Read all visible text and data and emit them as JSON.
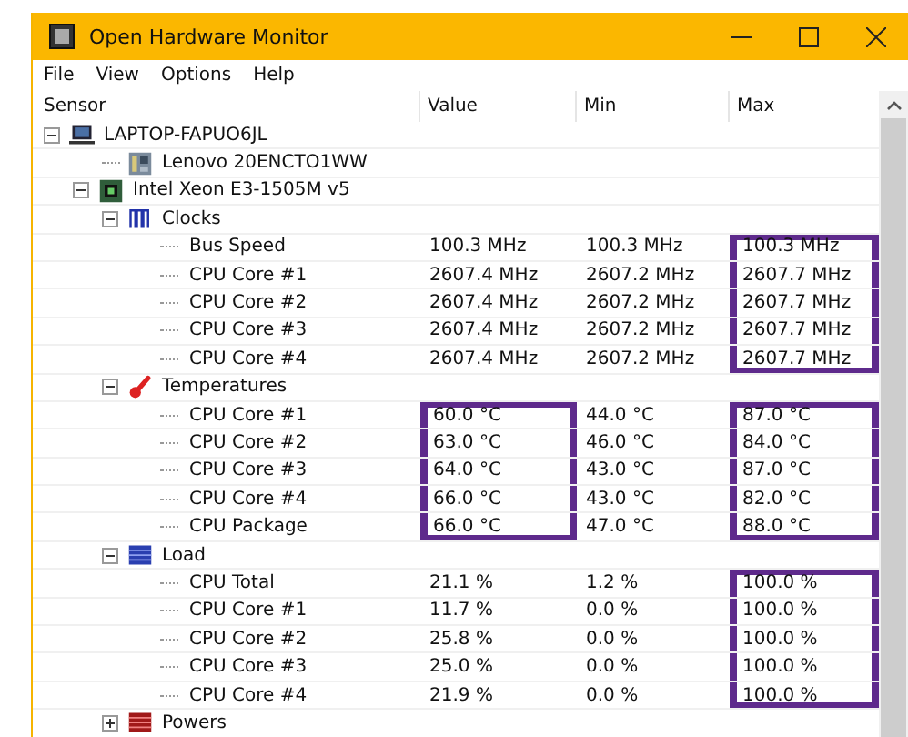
{
  "window": {
    "title": "Open Hardware Monitor"
  },
  "menu": [
    "File",
    "View",
    "Options",
    "Help"
  ],
  "columns": [
    "Sensor",
    "Value",
    "Min",
    "Max"
  ],
  "tree": [
    {
      "name": "LAPTOP-FAPUO6JL",
      "kind": "computer",
      "expanded": true,
      "children": [
        {
          "name": "Lenovo 20ENCTO1WW",
          "kind": "motherboard"
        },
        {
          "name": "Intel Xeon E3-1505M v5",
          "kind": "cpu",
          "expanded": true,
          "children": [
            {
              "name": "Clocks",
              "kind": "clock",
              "expanded": true,
              "children": [
                {
                  "name": "Bus Speed",
                  "value": {
                    "text": "100.3 MHz",
                    "boxed": false
                  },
                  "min": {
                    "text": "100.3 MHz",
                    "boxed": false
                  },
                  "max": {
                    "text": "100.3 MHz",
                    "boxed": true
                  }
                },
                {
                  "name": "CPU Core #1",
                  "value": {
                    "text": "2607.4 MHz",
                    "boxed": false
                  },
                  "min": {
                    "text": "2607.2 MHz",
                    "boxed": false
                  },
                  "max": {
                    "text": "2607.7 MHz",
                    "boxed": true
                  }
                },
                {
                  "name": "CPU Core #2",
                  "value": {
                    "text": "2607.4 MHz",
                    "boxed": false
                  },
                  "min": {
                    "text": "2607.2 MHz",
                    "boxed": false
                  },
                  "max": {
                    "text": "2607.7 MHz",
                    "boxed": true
                  }
                },
                {
                  "name": "CPU Core #3",
                  "value": {
                    "text": "2607.4 MHz",
                    "boxed": false
                  },
                  "min": {
                    "text": "2607.2 MHz",
                    "boxed": false
                  },
                  "max": {
                    "text": "2607.7 MHz",
                    "boxed": true
                  }
                },
                {
                  "name": "CPU Core #4",
                  "value": {
                    "text": "2607.4 MHz",
                    "boxed": false
                  },
                  "min": {
                    "text": "2607.2 MHz",
                    "boxed": false
                  },
                  "max": {
                    "text": "2607.7 MHz",
                    "boxed": true
                  }
                }
              ]
            },
            {
              "name": "Temperatures",
              "kind": "temperature",
              "expanded": true,
              "children": [
                {
                  "name": "CPU Core #1",
                  "value": {
                    "text": "60.0 °C",
                    "boxed": true
                  },
                  "min": {
                    "text": "44.0 °C",
                    "boxed": false
                  },
                  "max": {
                    "text": "87.0 °C",
                    "boxed": true
                  }
                },
                {
                  "name": "CPU Core #2",
                  "value": {
                    "text": "63.0 °C",
                    "boxed": true
                  },
                  "min": {
                    "text": "46.0 °C",
                    "boxed": false
                  },
                  "max": {
                    "text": "84.0 °C",
                    "boxed": true
                  }
                },
                {
                  "name": "CPU Core #3",
                  "value": {
                    "text": "64.0 °C",
                    "boxed": true
                  },
                  "min": {
                    "text": "43.0 °C",
                    "boxed": false
                  },
                  "max": {
                    "text": "87.0 °C",
                    "boxed": true
                  }
                },
                {
                  "name": "CPU Core #4",
                  "value": {
                    "text": "66.0 °C",
                    "boxed": true
                  },
                  "min": {
                    "text": "43.0 °C",
                    "boxed": false
                  },
                  "max": {
                    "text": "82.0 °C",
                    "boxed": true
                  }
                },
                {
                  "name": "CPU Package",
                  "value": {
                    "text": "66.0 °C",
                    "boxed": true
                  },
                  "min": {
                    "text": "47.0 °C",
                    "boxed": false
                  },
                  "max": {
                    "text": "88.0 °C",
                    "boxed": true
                  }
                }
              ]
            },
            {
              "name": "Load",
              "kind": "load",
              "expanded": true,
              "children": [
                {
                  "name": "CPU Total",
                  "value": {
                    "text": "21.1 %",
                    "boxed": false
                  },
                  "min": {
                    "text": "1.2 %",
                    "boxed": false
                  },
                  "max": {
                    "text": "100.0 %",
                    "boxed": true
                  }
                },
                {
                  "name": "CPU Core #1",
                  "value": {
                    "text": "11.7 %",
                    "boxed": false
                  },
                  "min": {
                    "text": "0.0 %",
                    "boxed": false
                  },
                  "max": {
                    "text": "100.0 %",
                    "boxed": true
                  }
                },
                {
                  "name": "CPU Core #2",
                  "value": {
                    "text": "25.8 %",
                    "boxed": false
                  },
                  "min": {
                    "text": "0.0 %",
                    "boxed": false
                  },
                  "max": {
                    "text": "100.0 %",
                    "boxed": true
                  }
                },
                {
                  "name": "CPU Core #3",
                  "value": {
                    "text": "25.0 %",
                    "boxed": false
                  },
                  "min": {
                    "text": "0.0 %",
                    "boxed": false
                  },
                  "max": {
                    "text": "100.0 %",
                    "boxed": true
                  }
                },
                {
                  "name": "CPU Core #4",
                  "value": {
                    "text": "21.9 %",
                    "boxed": false
                  },
                  "min": {
                    "text": "0.0 %",
                    "boxed": false
                  },
                  "max": {
                    "text": "100.0 %",
                    "boxed": true
                  }
                }
              ]
            },
            {
              "name": "Powers",
              "kind": "power",
              "expanded": false
            }
          ]
        }
      ]
    }
  ]
}
